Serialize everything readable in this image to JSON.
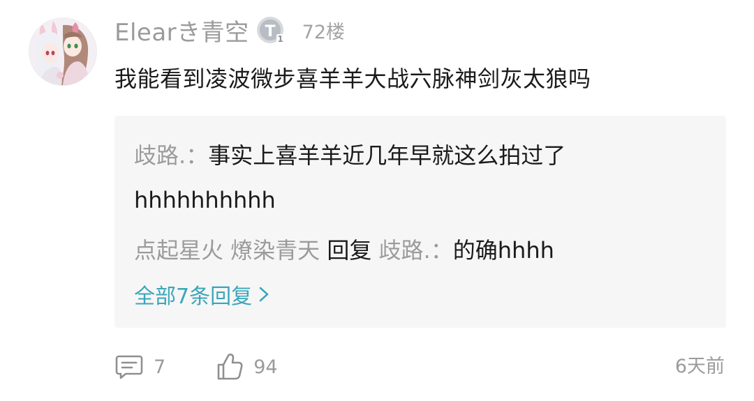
{
  "comment": {
    "username": "Elearき青空",
    "level_badge": "T1",
    "floor": "72楼",
    "content": "我能看到凌波微步喜羊羊大战六脉神剑灰太狼吗",
    "time": "6天前",
    "reply_count": "7",
    "like_count": "94",
    "avatar_icon": "anime-avatar-icon",
    "level_icon": "level-badge-icon",
    "comment_icon": "comment-bubble-icon",
    "like_icon": "thumbs-up-icon"
  },
  "replies": [
    {
      "author": "歧路.",
      "separator": "：",
      "text": "事实上喜羊羊近几年早就这么拍过了",
      "text_cont": "hhhhhhhhhh"
    },
    {
      "author": "点起星火 燎染青天",
      "reply_word": " 回复 ",
      "target": "歧路.",
      "separator": "：",
      "text": "的确hhhh"
    }
  ],
  "more_replies": {
    "label": "全部7条回复",
    "icon": "chevron-right-icon"
  },
  "colors": {
    "link": "#3aa6b9",
    "meta": "#9b9b9b",
    "text": "#1a1a1a",
    "reply_bg": "#f6f6f6"
  }
}
